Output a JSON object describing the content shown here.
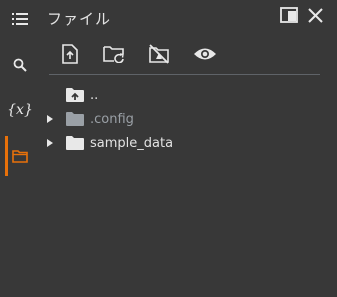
{
  "sidebar": {
    "items": [
      {
        "name": "table-of-contents",
        "icon": "list-icon"
      },
      {
        "name": "search",
        "icon": "search-icon"
      },
      {
        "name": "variables",
        "icon": "variables-icon",
        "label": "{x}"
      },
      {
        "name": "files",
        "icon": "folder-icon",
        "active": true
      }
    ]
  },
  "panel": {
    "title": "ファイル",
    "window_buttons": [
      "maximize-icon",
      "close-icon"
    ],
    "toolbar": [
      "upload-file-icon",
      "refresh-folder-icon",
      "mount-drive-off-icon",
      "show-hidden-files-icon"
    ]
  },
  "tree": {
    "parent": "..",
    "items": [
      {
        "name": ".config",
        "dimmed": true
      },
      {
        "name": "sample_data",
        "dimmed": false
      }
    ]
  },
  "colors": {
    "background": "#383838",
    "accent": "#e8710a",
    "text": "#e3e3e3",
    "dimmed_text": "#9aa0a6"
  }
}
